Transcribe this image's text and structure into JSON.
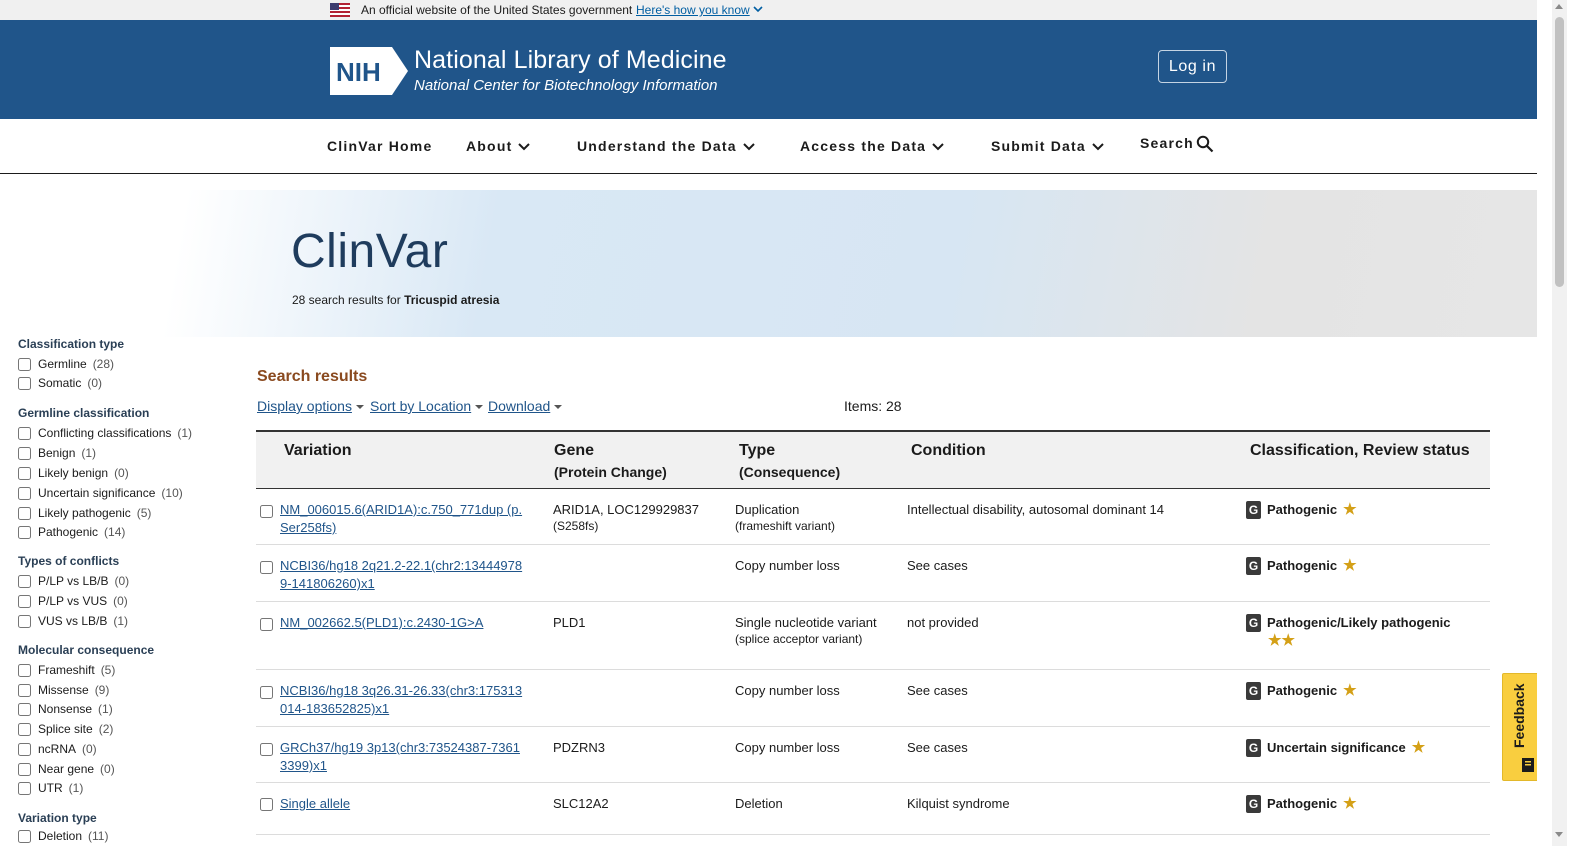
{
  "gov_banner": {
    "text": "An official website of the United States government",
    "link": "Here's how you know"
  },
  "header": {
    "logo_text": "NIH",
    "title": "National Library of Medicine",
    "subtitle": "National Center for Biotechnology Information",
    "login_label": "Log in"
  },
  "nav": {
    "home": "ClinVar Home",
    "about": "About",
    "understand": "Understand the Data",
    "access": "Access the Data",
    "submit": "Submit Data",
    "search": "Search"
  },
  "hero": {
    "title": "ClinVar",
    "results_prefix": "28 search results for",
    "query": "Tricuspid atresia"
  },
  "sidebar": {
    "classification_type": {
      "title": "Classification type",
      "items": [
        {
          "label": "Germline",
          "count": "(28)"
        },
        {
          "label": "Somatic",
          "count": "(0)"
        }
      ]
    },
    "germline_classification": {
      "title": "Germline classification",
      "items": [
        {
          "label": "Conflicting classifications",
          "count": "(1)"
        },
        {
          "label": "Benign",
          "count": "(1)"
        },
        {
          "label": "Likely benign",
          "count": "(0)"
        },
        {
          "label": "Uncertain significance",
          "count": "(10)"
        },
        {
          "label": "Likely pathogenic",
          "count": "(5)"
        },
        {
          "label": "Pathogenic",
          "count": "(14)"
        }
      ]
    },
    "types_of_conflicts": {
      "title": "Types of conflicts",
      "items": [
        {
          "label": "P/LP vs LB/B",
          "count": "(0)"
        },
        {
          "label": "P/LP vs VUS",
          "count": "(0)"
        },
        {
          "label": "VUS vs LB/B",
          "count": "(1)"
        }
      ]
    },
    "molecular_consequence": {
      "title": "Molecular consequence",
      "items": [
        {
          "label": "Frameshift",
          "count": "(5)"
        },
        {
          "label": "Missense",
          "count": "(9)"
        },
        {
          "label": "Nonsense",
          "count": "(1)"
        },
        {
          "label": "Splice site",
          "count": "(2)"
        },
        {
          "label": "ncRNA",
          "count": "(0)"
        },
        {
          "label": "Near gene",
          "count": "(0)"
        },
        {
          "label": "UTR",
          "count": "(1)"
        }
      ]
    },
    "variation_type": {
      "title": "Variation type",
      "items": [
        {
          "label": "Deletion",
          "count": "(11)"
        }
      ]
    }
  },
  "results": {
    "title": "Search results",
    "display_options": "Display options",
    "sort_by": "Sort by Location",
    "download": "Download",
    "items": "Items: 28",
    "columns": {
      "variation": "Variation",
      "gene": "Gene",
      "gene_sub": "(Protein Change)",
      "type": "Type",
      "type_sub": "(Consequence)",
      "condition": "Condition",
      "classification": "Classification, Review status"
    },
    "rows": [
      {
        "variation": "NM_006015.6(ARID1A):c.750_771dup (p.Ser258fs)",
        "gene": "ARID1A, LOC129929837",
        "gene_sub": "(S258fs)",
        "type": "Duplication",
        "type_sub": "(frameshift variant)",
        "condition": "Intellectual disability, autosomal dominant 14",
        "badge": "G",
        "classification": "Pathogenic",
        "stars": "★"
      },
      {
        "variation": "NCBI36/hg18 2q21.2-22.1(chr2:134449789-141806260)x1",
        "gene": "",
        "gene_sub": "",
        "type": "Copy number loss",
        "type_sub": "",
        "condition": "See cases",
        "badge": "G",
        "classification": "Pathogenic",
        "stars": "★"
      },
      {
        "variation": "NM_002662.5(PLD1):c.2430-1G>A",
        "gene": "PLD1",
        "gene_sub": "",
        "type": "Single nucleotide variant",
        "type_sub": "(splice acceptor variant)",
        "condition": "not provided",
        "badge": "G",
        "classification": "Pathogenic/Likely pathogenic",
        "stars": "★★"
      },
      {
        "variation": "NCBI36/hg18 3q26.31-26.33(chr3:175313014-183652825)x1",
        "gene": "",
        "gene_sub": "",
        "type": "Copy number loss",
        "type_sub": "",
        "condition": "See cases",
        "badge": "G",
        "classification": "Pathogenic",
        "stars": "★"
      },
      {
        "variation": "GRCh37/hg19 3p13(chr3:73524387-73613399)x1",
        "gene": "PDZRN3",
        "gene_sub": "",
        "type": "Copy number loss",
        "type_sub": "",
        "condition": "See cases",
        "badge": "G",
        "classification": "Uncertain significance",
        "stars": "★"
      },
      {
        "variation": "Single allele",
        "gene": "SLC12A2",
        "gene_sub": "",
        "type": "Deletion",
        "type_sub": "",
        "condition": "Kilquist syndrome",
        "badge": "G",
        "classification": "Pathogenic",
        "stars": "★"
      }
    ]
  },
  "feedback": {
    "label": "Feedback"
  },
  "colors": {
    "header_bg": "#20558a",
    "link": "#20558a",
    "results_title": "#8a4a1f",
    "star": "#d4a017",
    "feedback_bg": "#f9ce3f"
  }
}
